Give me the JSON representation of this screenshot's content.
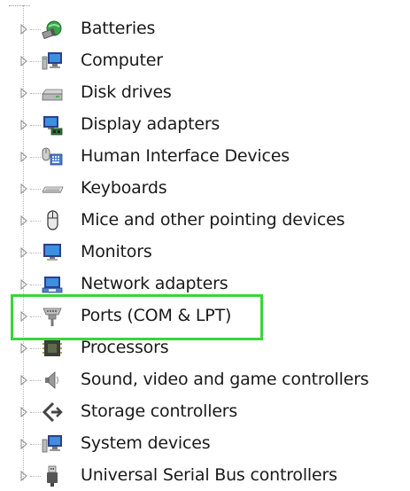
{
  "tree": {
    "items": [
      {
        "label": "Batteries",
        "icon": "battery-icon"
      },
      {
        "label": "Computer",
        "icon": "computer-icon"
      },
      {
        "label": "Disk drives",
        "icon": "disk-drive-icon"
      },
      {
        "label": "Display adapters",
        "icon": "display-adapter-icon"
      },
      {
        "label": "Human Interface Devices",
        "icon": "hid-icon"
      },
      {
        "label": "Keyboards",
        "icon": "keyboard-icon"
      },
      {
        "label": "Mice and other pointing devices",
        "icon": "mouse-icon"
      },
      {
        "label": "Monitors",
        "icon": "monitor-icon"
      },
      {
        "label": "Network adapters",
        "icon": "network-adapter-icon"
      },
      {
        "label": "Ports (COM & LPT)",
        "icon": "port-icon"
      },
      {
        "label": "Processors",
        "icon": "processor-icon"
      },
      {
        "label": "Sound, video and game controllers",
        "icon": "speaker-icon"
      },
      {
        "label": "Storage controllers",
        "icon": "storage-controller-icon"
      },
      {
        "label": "System devices",
        "icon": "system-device-icon"
      },
      {
        "label": "Universal Serial Bus controllers",
        "icon": "usb-icon"
      }
    ]
  },
  "highlight": {
    "target": "Ports (COM & LPT)",
    "color": "#3bd43b"
  }
}
